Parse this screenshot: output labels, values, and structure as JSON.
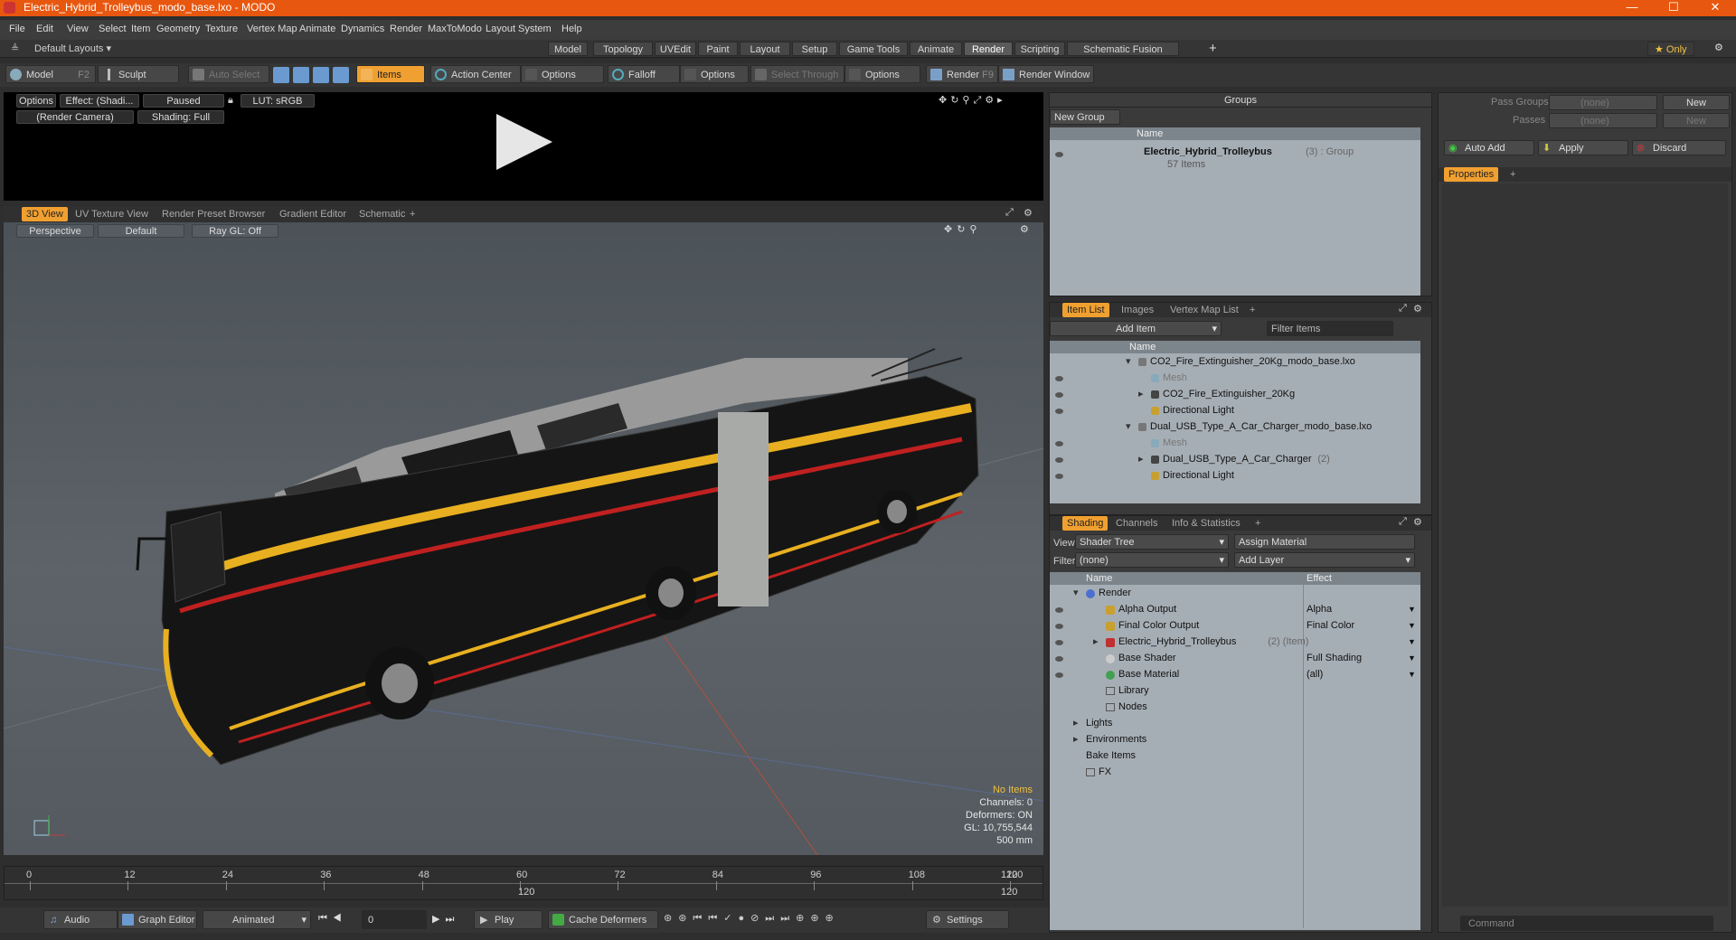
{
  "window": {
    "title": "Electric_Hybrid_Trolleybus_modo_base.lxo - MODO",
    "min": "—",
    "max": "☐",
    "close": "✕"
  },
  "menu": [
    "File",
    "Edit",
    "View",
    "Select",
    "Item",
    "Geometry",
    "Texture",
    "Vertex Map",
    "Animate",
    "Dynamics",
    "Render",
    "MaxToModo",
    "Layout",
    "System",
    "Help"
  ],
  "layouts": {
    "current": "Default Layouts ▾",
    "tabs": [
      "Model",
      "Topology",
      "UVEdit",
      "Paint",
      "Layout",
      "Setup",
      "Game Tools",
      "Animate",
      "Render",
      "Scripting",
      "Schematic Fusion"
    ],
    "active": "Render",
    "add": "+",
    "only": "★ Only"
  },
  "toolbar": {
    "model": "Model",
    "model_key": "F2",
    "sculpt": "Sculpt",
    "auto_select": "Auto Select",
    "items": "Items",
    "action_center": "Action Center",
    "options1": "Options",
    "falloff": "Falloff",
    "options2": "Options",
    "select_through": "Select Through",
    "options3": "Options",
    "render": "Render",
    "render_key": "F9",
    "render_window": "Render Window"
  },
  "preview": {
    "options": "Options",
    "effect": "Effect: (Shadi...",
    "paused": "Paused",
    "lut": "LUT: sRGB",
    "camera": "(Render Camera)",
    "shading": "Shading: Full"
  },
  "viewtabs": {
    "tabs": [
      "3D View",
      "UV Texture View",
      "Render Preset Browser",
      "Gradient Editor",
      "Schematic"
    ],
    "active": "3D View",
    "add": "+"
  },
  "viewport": {
    "perspective": "Perspective",
    "default": "Default",
    "raygl": "Ray GL: Off",
    "stats": [
      "No Items",
      "Channels: 0",
      "Deformers: ON",
      "GL: 10,755,544",
      "500 mm"
    ]
  },
  "timeline": {
    "ticks": [
      "0",
      "12",
      "24",
      "36",
      "48",
      "60",
      "72",
      "84",
      "96",
      "108",
      "120"
    ],
    "end_top": "120",
    "mid": "120"
  },
  "bottombar": {
    "audio": "Audio",
    "graph_editor": "Graph Editor",
    "animated": "Animated",
    "frame": "0",
    "play": "Play",
    "cache": "Cache Deformers",
    "settings": "Settings"
  },
  "groups": {
    "header": "Groups",
    "new_group": "New Group",
    "col_name": "Name",
    "item_name": "Electric_Hybrid_Trolleybus",
    "item_count": "(3)",
    "item_type": ": Group",
    "item_sub": "57 Items"
  },
  "passes": {
    "pass_groups": "Pass Groups",
    "passes": "Passes",
    "none": "(none)",
    "new": "New",
    "auto_add": "Auto Add",
    "apply": "Apply",
    "discard": "Discard",
    "properties": "Properties",
    "add": "+",
    "command": "Command"
  },
  "itemlist": {
    "tabs": [
      "Item List",
      "Images",
      "Vertex Map List"
    ],
    "active": "Item List",
    "add": "+",
    "add_item": "Add Item",
    "filter": "Filter Items",
    "col_name": "Name",
    "rows": [
      {
        "text": "CO2_Fire_Extinguisher_20Kg_modo_base.lxo",
        "indent": 0,
        "kind": "scene",
        "dim": false,
        "count": ""
      },
      {
        "text": "Mesh",
        "indent": 1,
        "kind": "mesh",
        "dim": true,
        "count": ""
      },
      {
        "text": "CO2_Fire_Extinguisher_20Kg",
        "indent": 1,
        "kind": "locator",
        "dim": false,
        "count": ""
      },
      {
        "text": "Directional Light",
        "indent": 1,
        "kind": "light",
        "dim": false,
        "count": ""
      },
      {
        "text": "Dual_USB_Type_A_Car_Charger_modo_base.lxo",
        "indent": 0,
        "kind": "scene",
        "dim": false,
        "count": ""
      },
      {
        "text": "Mesh",
        "indent": 1,
        "kind": "mesh",
        "dim": true,
        "count": ""
      },
      {
        "text": "Dual_USB_Type_A_Car_Charger",
        "indent": 1,
        "kind": "locator",
        "dim": false,
        "count": "(2)"
      },
      {
        "text": "Directional Light",
        "indent": 1,
        "kind": "light",
        "dim": false,
        "count": ""
      }
    ]
  },
  "shading": {
    "tabs": [
      "Shading",
      "Channels",
      "Info & Statistics"
    ],
    "active": "Shading",
    "add": "+",
    "view_label": "View",
    "view_value": "Shader Tree",
    "assign": "Assign Material",
    "filter_label": "Filter",
    "filter_value": "(none)",
    "add_layer": "Add Layer",
    "col_name": "Name",
    "col_effect": "Effect",
    "rows": [
      {
        "text": "Render",
        "effect": "",
        "indent": 0,
        "color": "#4a6fd0",
        "count": ""
      },
      {
        "text": "Alpha Output",
        "effect": "Alpha",
        "indent": 1,
        "color": "#c8a030",
        "count": ""
      },
      {
        "text": "Final Color Output",
        "effect": "Final Color",
        "indent": 1,
        "color": "#c8a030",
        "count": ""
      },
      {
        "text": "Electric_Hybrid_Trolleybus",
        "effect": "",
        "indent": 1,
        "color": "#c03030",
        "count": "(2) (Item)"
      },
      {
        "text": "Base Shader",
        "effect": "Full Shading",
        "indent": 1,
        "color": "#cccccc",
        "count": ""
      },
      {
        "text": "Base Material",
        "effect": "(all)",
        "indent": 1,
        "color": "#40a050",
        "count": ""
      },
      {
        "text": "Library",
        "effect": "",
        "indent": 1,
        "color": "",
        "count": ""
      },
      {
        "text": "Nodes",
        "effect": "",
        "indent": 1,
        "color": "",
        "count": ""
      },
      {
        "text": "Lights",
        "effect": "",
        "indent": 0,
        "color": "",
        "count": ""
      },
      {
        "text": "Environments",
        "effect": "",
        "indent": 0,
        "color": "",
        "count": ""
      },
      {
        "text": "Bake Items",
        "effect": "",
        "indent": 0,
        "color": "",
        "count": ""
      },
      {
        "text": "FX",
        "effect": "",
        "indent": 0,
        "color": "",
        "count": ""
      }
    ]
  },
  "colors": {
    "accent": "#f0a030",
    "titlebar": "#e8570f"
  }
}
